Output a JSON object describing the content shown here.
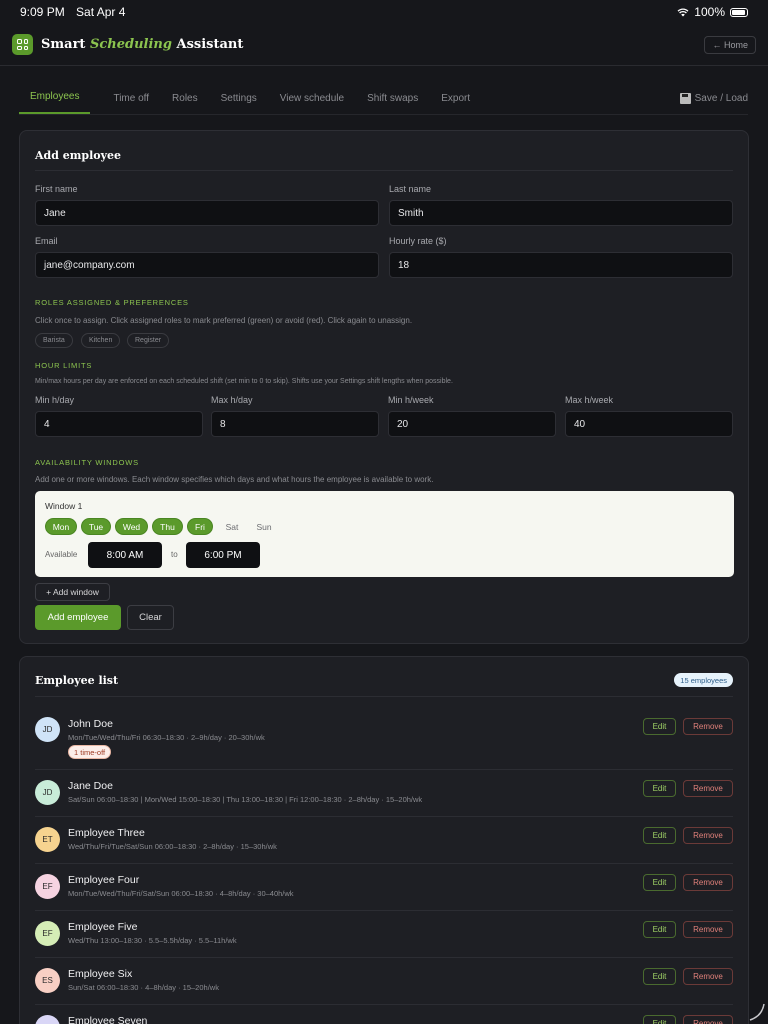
{
  "status": {
    "time": "9:09 PM",
    "date": "Sat Apr 4",
    "battery": "100%"
  },
  "app": {
    "title_prefix": "Smart ",
    "title_em": "Scheduling",
    "title_suffix": " Assistant",
    "home_label": "← Home"
  },
  "tabs": [
    {
      "label": "Employees",
      "active": true
    },
    {
      "label": "Time off"
    },
    {
      "label": "Roles"
    },
    {
      "label": "Settings"
    },
    {
      "label": "View schedule"
    },
    {
      "label": "Shift swaps"
    },
    {
      "label": "Export"
    }
  ],
  "save_load_label": "Save / Load",
  "add_form": {
    "title": "Add employee",
    "first_name": {
      "label": "First name",
      "value": "Jane"
    },
    "last_name": {
      "label": "Last name",
      "value": "Smith"
    },
    "email": {
      "label": "Email",
      "value": "jane@company.com"
    },
    "rate": {
      "label": "Hourly rate ($)",
      "value": "18"
    },
    "roles_heading": "Roles assigned & preferences",
    "roles_hint": "Click once to assign. Click assigned roles to mark preferred (green) or avoid (red). Click again to unassign.",
    "roles": [
      "Barista",
      "Kitchen",
      "Register"
    ],
    "limits_heading": "Hour limits",
    "limits_hint": "Min/max hours per day are enforced on each scheduled shift (set min to 0 to skip). Shifts use your Settings shift lengths when possible.",
    "limits": [
      {
        "label": "Min h/day",
        "value": "4"
      },
      {
        "label": "Max h/day",
        "value": "8"
      },
      {
        "label": "Min h/week",
        "value": "20"
      },
      {
        "label": "Max h/week",
        "value": "40"
      }
    ],
    "availability_heading": "Availability windows",
    "availability_hint": "Add one or more windows. Each window specifies which days and what hours the employee is available to work.",
    "window": {
      "title": "Window 1",
      "days": [
        {
          "label": "Mon",
          "on": true
        },
        {
          "label": "Tue",
          "on": true
        },
        {
          "label": "Wed",
          "on": true
        },
        {
          "label": "Thu",
          "on": true
        },
        {
          "label": "Fri",
          "on": true
        },
        {
          "label": "Sat",
          "on": false
        },
        {
          "label": "Sun",
          "on": false
        }
      ],
      "available_label": "Available",
      "start": "8:00 AM",
      "to_label": "to",
      "end": "6:00 PM"
    },
    "add_window_label": "+ Add window",
    "submit_label": "Add employee",
    "clear_label": "Clear"
  },
  "list": {
    "title": "Employee list",
    "count_label": "15 employees",
    "edit_label": "Edit",
    "remove_label": "Remove",
    "employees": [
      {
        "initials": "JD",
        "name": "John Doe",
        "meta": "Mon/Tue/Wed/Thu/Fri 06:30–18:30 · 2–9h/day · 20–30h/wk",
        "badge": "1 time-off",
        "color": "#cfe3f7"
      },
      {
        "initials": "JD",
        "name": "Jane Doe",
        "meta": "Sat/Sun 06:00–18:30 | Mon/Wed 15:00–18:30 | Thu 13:00–18:30 | Fri 12:00–18:30 · 2–8h/day · 15–20h/wk",
        "color": "#c8ecd8"
      },
      {
        "initials": "ET",
        "name": "Employee Three",
        "meta": "Wed/Thu/Fri/Tue/Sat/Sun 06:00–18:30 · 2–8h/day · 15–30h/wk",
        "color": "#f6d38f"
      },
      {
        "initials": "EF",
        "name": "Employee Four",
        "meta": "Mon/Tue/Wed/Thu/Fri/Sat/Sun 06:00–18:30 · 4–8h/day · 30–40h/wk",
        "color": "#f6d3e1"
      },
      {
        "initials": "EF",
        "name": "Employee Five",
        "meta": "Wed/Thu 13:00–18:30 · 5.5–5.5h/day · 5.5–11h/wk",
        "color": "#d5edb6"
      },
      {
        "initials": "ES",
        "name": "Employee Six",
        "meta": "Sun/Sat 06:00–18:30 · 4–8h/day · 15–20h/wk",
        "color": "#f8cfc4"
      },
      {
        "initials": "ES",
        "name": "Employee Seven",
        "meta": "",
        "color": "#d9d6f6"
      }
    ]
  }
}
